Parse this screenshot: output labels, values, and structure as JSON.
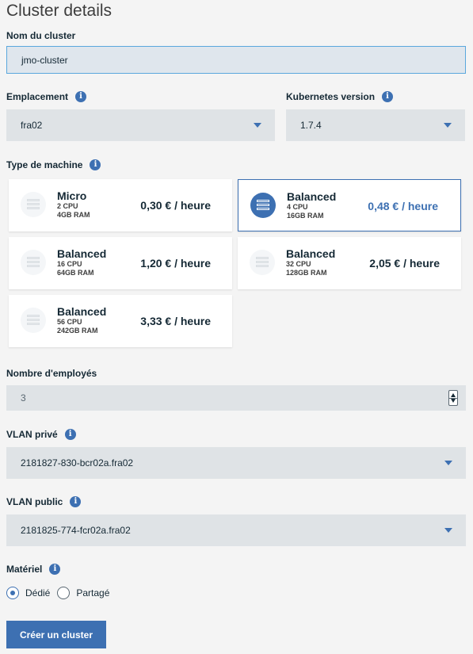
{
  "page_title": "Cluster details",
  "cluster_name": {
    "label": "Nom du cluster",
    "value": "jmo-cluster"
  },
  "location": {
    "label": "Emplacement",
    "value": "fra02",
    "icon": "info-icon"
  },
  "kubernetes": {
    "label": "Kubernetes version",
    "value": "1.7.4",
    "icon": "info-icon"
  },
  "machine_type": {
    "label": "Type de machine",
    "tiles": [
      {
        "name": "Micro",
        "cpu": "2 CPU",
        "ram": "4GB RAM",
        "price": "0,30 € / heure",
        "selected": false
      },
      {
        "name": "Balanced",
        "cpu": "4 CPU",
        "ram": "16GB RAM",
        "price": "0,48 € / heure",
        "selected": true
      },
      {
        "name": "Balanced",
        "cpu": "16 CPU",
        "ram": "64GB RAM",
        "price": "1,20 € / heure",
        "selected": false
      },
      {
        "name": "Balanced",
        "cpu": "32 CPU",
        "ram": "128GB RAM",
        "price": "2,05 € / heure",
        "selected": false
      },
      {
        "name": "Balanced",
        "cpu": "56 CPU",
        "ram": "242GB RAM",
        "price": "3,33 € / heure",
        "selected": false
      }
    ]
  },
  "workers": {
    "label": "Nombre d'employés",
    "value": "3"
  },
  "private_vlan": {
    "label": "VLAN privé",
    "value": "2181827-830-bcr02a.fra02"
  },
  "public_vlan": {
    "label": "VLAN public",
    "value": "2181825-774-fcr02a.fra02"
  },
  "hardware": {
    "label": "Matériel",
    "options": [
      {
        "label": "Dédié",
        "checked": true
      },
      {
        "label": "Partagé",
        "checked": false
      }
    ]
  },
  "create_button": "Créer un cluster",
  "colors": {
    "accent": "#3d70b2",
    "field_bg": "#dfe3e6",
    "page_bg": "#f4f4f4"
  }
}
